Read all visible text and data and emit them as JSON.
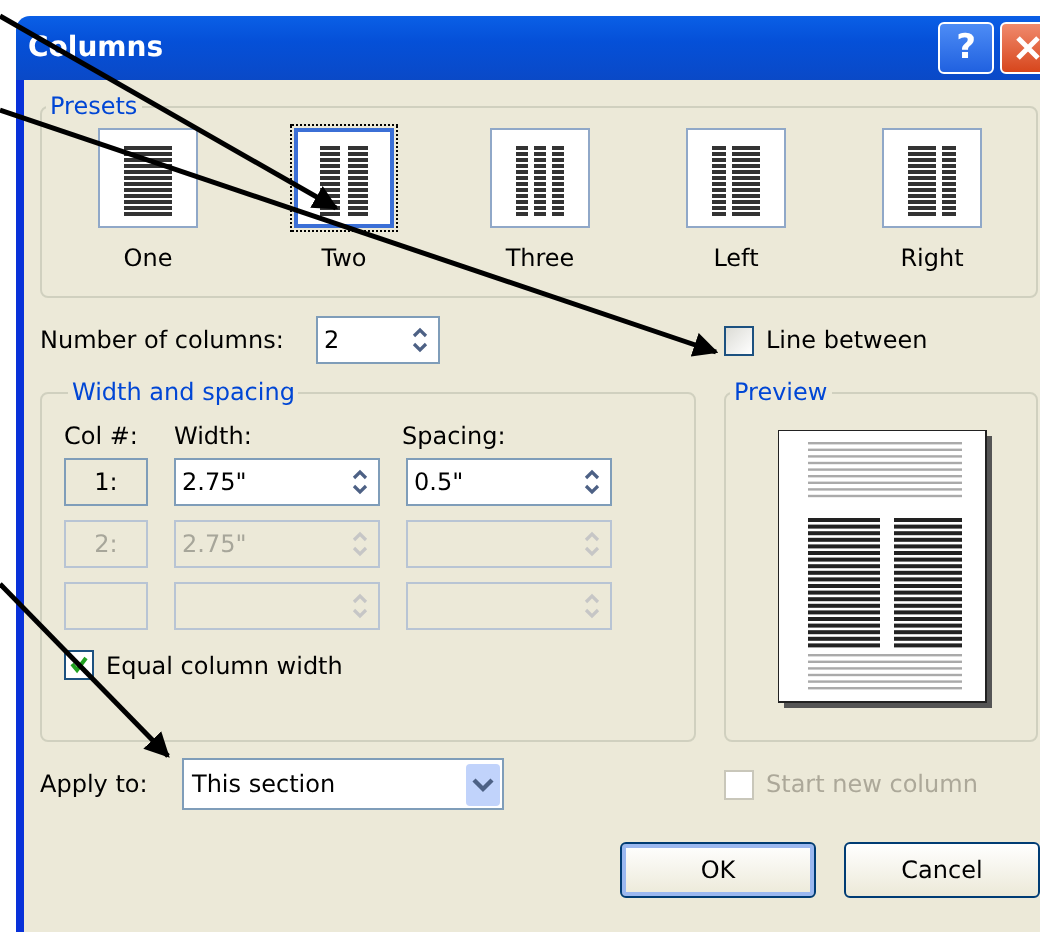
{
  "window": {
    "title": "Columns",
    "help": "?"
  },
  "presets": {
    "title": "Presets",
    "items": [
      {
        "label": "One",
        "kind": "one",
        "selected": false
      },
      {
        "label": "Two",
        "kind": "two",
        "selected": true
      },
      {
        "label": "Three",
        "kind": "three",
        "selected": false
      },
      {
        "label": "Left",
        "kind": "left",
        "selected": false
      },
      {
        "label": "Right",
        "kind": "right",
        "selected": false
      }
    ]
  },
  "number_of_columns": {
    "label": "Number of columns:",
    "value": "2"
  },
  "line_between": {
    "label": "Line between",
    "checked": false
  },
  "width_and_spacing": {
    "title": "Width and spacing",
    "headers": [
      "Col #:",
      "Width:",
      "Spacing:"
    ],
    "rows": [
      {
        "col": "1:",
        "width": "2.75\"",
        "spacing": "0.5\"",
        "disabled": false
      },
      {
        "col": "2:",
        "width": "2.75\"",
        "disabled": true
      },
      {
        "disabled": true
      }
    ]
  },
  "equal_column_width": {
    "label": "Equal column width",
    "checked": true
  },
  "preview": {
    "title": "Preview"
  },
  "apply_to": {
    "label": "Apply to:",
    "value": "This section"
  },
  "start_new_column": {
    "label": "Start new column",
    "checked": false,
    "disabled": true
  },
  "buttons": [
    "OK",
    "Cancel"
  ]
}
